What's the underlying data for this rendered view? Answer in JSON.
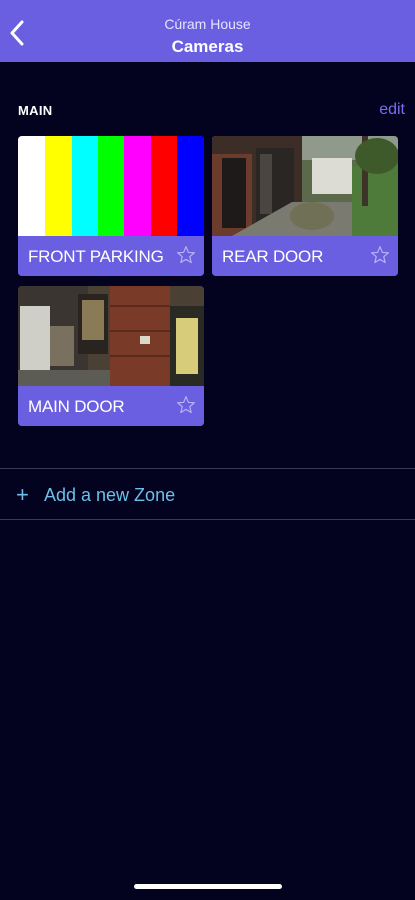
{
  "header": {
    "subtitle": "Cúram House",
    "title": "Cameras"
  },
  "section": {
    "label": "MAIN",
    "edit_label": "edit"
  },
  "cameras": [
    {
      "name": "FRONT PARKING",
      "icon": "star-outline-icon"
    },
    {
      "name": "REAR DOOR",
      "icon": "star-outline-icon"
    },
    {
      "name": "MAIN DOOR",
      "icon": "star-outline-icon"
    }
  ],
  "add_zone": {
    "plus": "+",
    "label": "Add a new Zone"
  },
  "colors": {
    "background": "#03031f",
    "accent": "#6a5fe0",
    "link": "#6cc0e8"
  }
}
